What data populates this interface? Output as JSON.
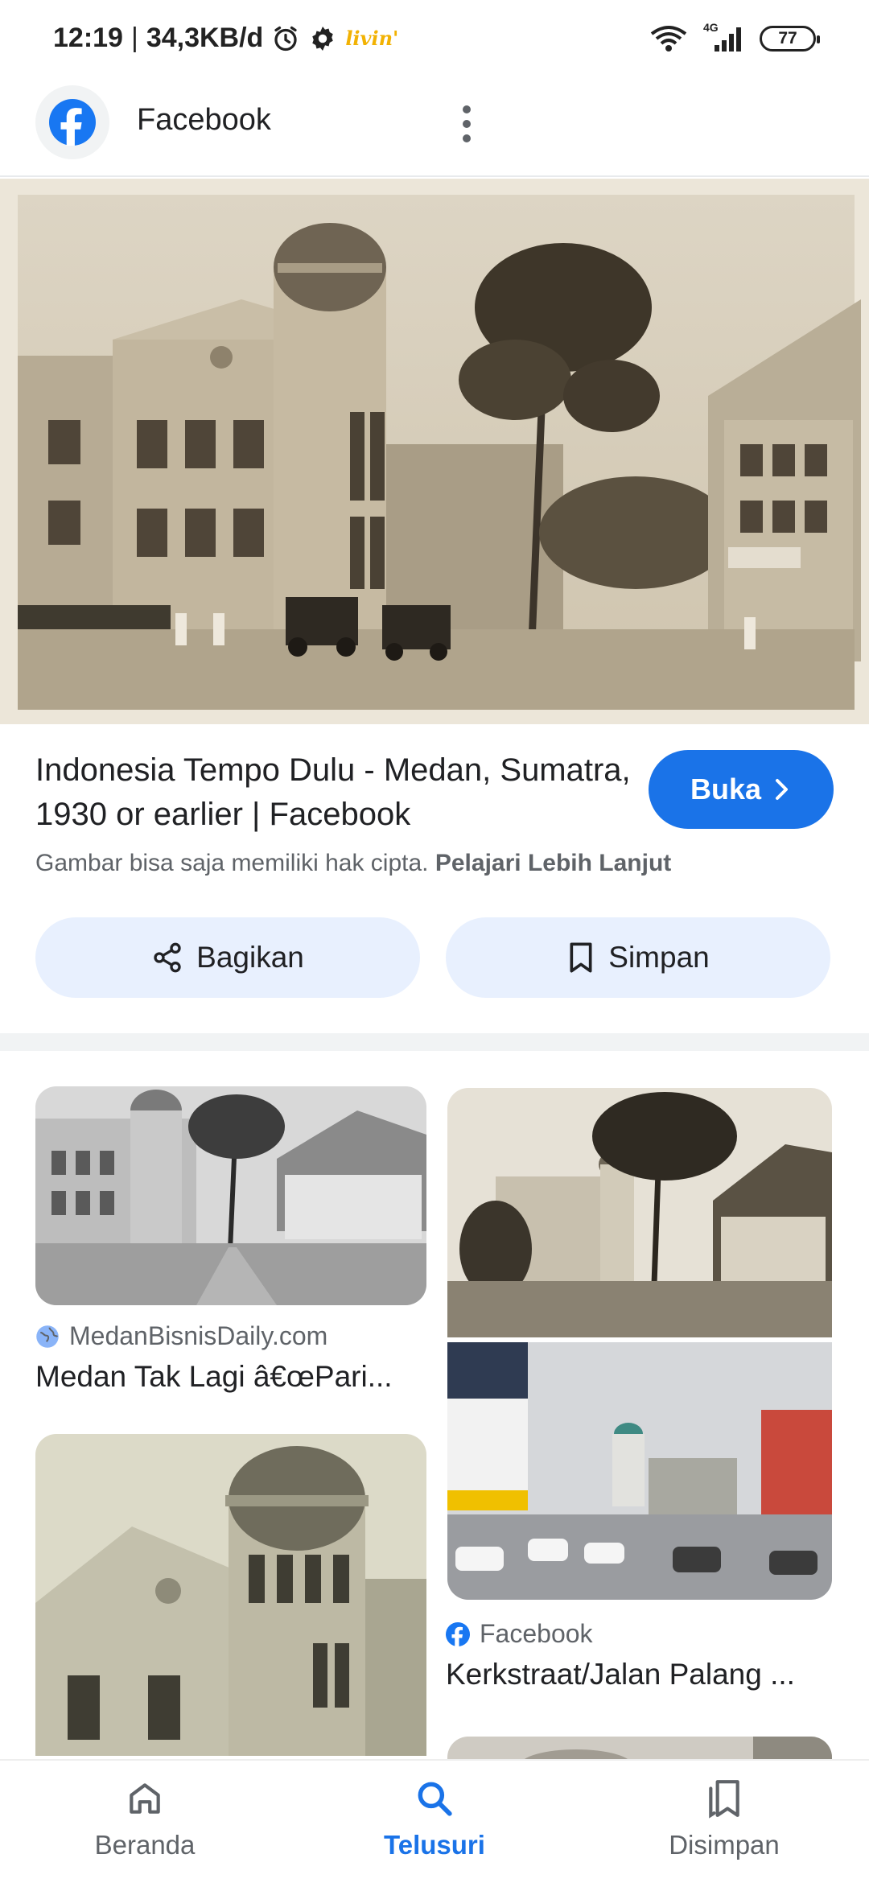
{
  "status_bar": {
    "time": "12:19",
    "separator": "|",
    "speed": "34,3KB/d",
    "livin_label": "livin'",
    "network": "4G",
    "battery": "77"
  },
  "app_bar": {
    "title": "Facebook"
  },
  "result": {
    "title": "Indonesia Tempo Dulu - Medan, Sumatra, 1930 or earlier | Facebook",
    "open_label": "Buka",
    "copyright_text": "Gambar bisa saja memiliki hak cipta.",
    "learn_more_label": "Pelajari Lebih Lanjut",
    "share_label": "Bagikan",
    "save_label": "Simpan"
  },
  "related": [
    {
      "source": "MedanBisnisDaily.com",
      "caption": "Medan Tak Lagi â€œPari..."
    },
    {
      "source": "Facebook",
      "caption": "Kerkstraat/Jalan Palang ..."
    }
  ],
  "bottom_nav": {
    "home": "Beranda",
    "search": "Telusuri",
    "saved": "Disimpan"
  },
  "colors": {
    "accent": "#1a73e8",
    "button_tint": "#e8f0fe",
    "facebook_blue": "#1877f2"
  }
}
